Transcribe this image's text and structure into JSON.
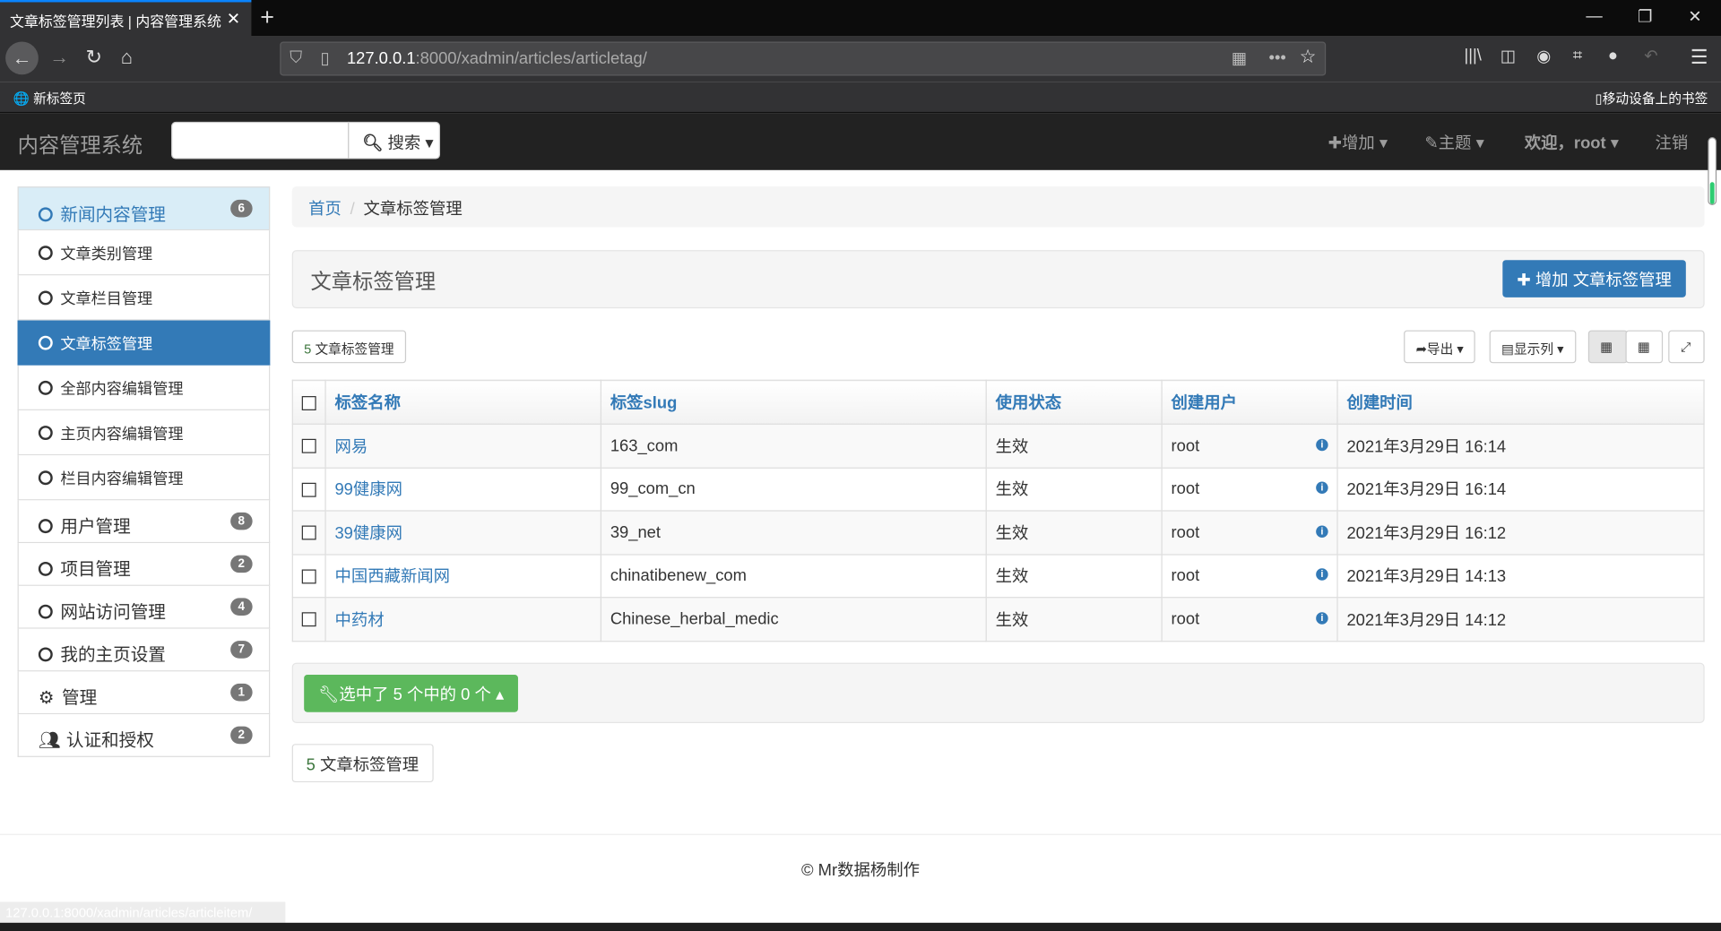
{
  "browser": {
    "tab_title": "文章标签管理列表 | 内容管理系统",
    "url_host": "127.0.0.1",
    "url_rest": ":8000/xadmin/articles/articletag/",
    "bookmark_left": "新标签页",
    "bookmark_right": "移动设备上的书签",
    "status_url": "127.0.0.1:8000/xadmin/articles/articleitem/"
  },
  "header": {
    "brand": "内容管理系统",
    "search_placeholder": "",
    "search_label": "搜索",
    "add": "增加",
    "theme": "主题",
    "welcome": "欢迎，root",
    "logout": "注销"
  },
  "sidebar": {
    "items": [
      {
        "label": "新闻内容管理",
        "badge": "6"
      },
      {
        "label": "文章类别管理"
      },
      {
        "label": "文章栏目管理"
      },
      {
        "label": "文章标签管理"
      },
      {
        "label": "全部内容编辑管理"
      },
      {
        "label": "主页内容编辑管理"
      },
      {
        "label": "栏目内容编辑管理"
      },
      {
        "label": "用户管理",
        "badge": "8"
      },
      {
        "label": "项目管理",
        "badge": "2"
      },
      {
        "label": "网站访问管理",
        "badge": "4"
      },
      {
        "label": "我的主页设置",
        "badge": "7"
      },
      {
        "label": "管理",
        "badge": "1"
      },
      {
        "label": "认证和授权",
        "badge": "2"
      }
    ]
  },
  "breadcrumb": {
    "home": "首页",
    "current": "文章标签管理"
  },
  "page": {
    "title": "文章标签管理",
    "add_button": "增加 文章标签管理",
    "count": "5",
    "count_label": "文章标签管理",
    "export": "导出",
    "columns": "显示列",
    "action": "选中了 5 个中的 0 个"
  },
  "table": {
    "headers": [
      "标签名称",
      "标签slug",
      "使用状态",
      "创建用户",
      "创建时间"
    ],
    "rows": [
      [
        "网易",
        "163_com",
        "生效",
        "root",
        "2021年3月29日 16:14"
      ],
      [
        "99健康网",
        "99_com_cn",
        "生效",
        "root",
        "2021年3月29日 16:14"
      ],
      [
        "39健康网",
        "39_net",
        "生效",
        "root",
        "2021年3月29日 16:12"
      ],
      [
        "中国西藏新闻网",
        "chinatibenew_com",
        "生效",
        "root",
        "2021年3月29日 14:13"
      ],
      [
        "中药材",
        "Chinese_herbal_medic",
        "生效",
        "root",
        "2021年3月29日 14:12"
      ]
    ]
  },
  "footer": {
    "text": "© Mr数据杨制作"
  }
}
